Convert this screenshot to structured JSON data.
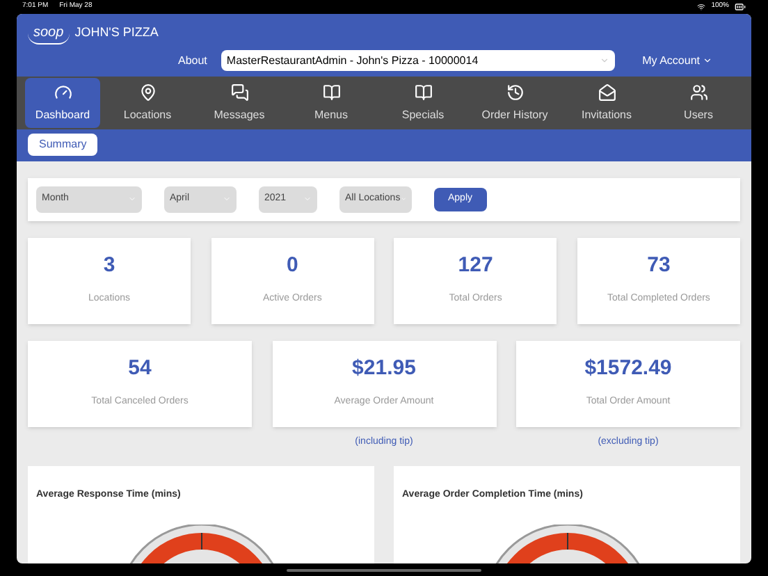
{
  "status_bar": {
    "time": "7:01 PM",
    "date": "Fri May 28",
    "battery": "100%"
  },
  "header": {
    "logo": "soop",
    "restaurant": "JOHN'S PIZZA",
    "about": "About",
    "account_select": "MasterRestaurantAdmin - John's Pizza - 10000014",
    "my_account": "My Account"
  },
  "nav": [
    {
      "label": "Dashboard",
      "selected": true
    },
    {
      "label": "Locations",
      "selected": false
    },
    {
      "label": "Messages",
      "selected": false
    },
    {
      "label": "Menus",
      "selected": false
    },
    {
      "label": "Specials",
      "selected": false
    },
    {
      "label": "Order History",
      "selected": false
    },
    {
      "label": "Invitations",
      "selected": false
    },
    {
      "label": "Users",
      "selected": false
    }
  ],
  "subnav": [
    {
      "label": "Summary",
      "selected": true
    }
  ],
  "filters": {
    "selects": [
      "Month",
      "April",
      "2021",
      "All Locations"
    ],
    "apply": "Apply"
  },
  "stats_row_1": [
    {
      "value": "3",
      "label": "Locations"
    },
    {
      "value": "0",
      "label": "Active Orders"
    },
    {
      "value": "127",
      "label": "Total Orders"
    },
    {
      "value": "73",
      "label": "Total Completed Orders"
    }
  ],
  "stats_row_2": [
    {
      "value": "54",
      "label": "Total Canceled Orders"
    },
    {
      "value": "$21.95",
      "label": "Average Order Amount",
      "note": "(including tip)"
    },
    {
      "value": "$1572.49",
      "label": "Total Order Amount",
      "note": "(excluding tip)"
    }
  ],
  "gauges": [
    {
      "title": "Average Response Time (mins)"
    },
    {
      "title": "Average Order Completion Time (mins)"
    }
  ]
}
